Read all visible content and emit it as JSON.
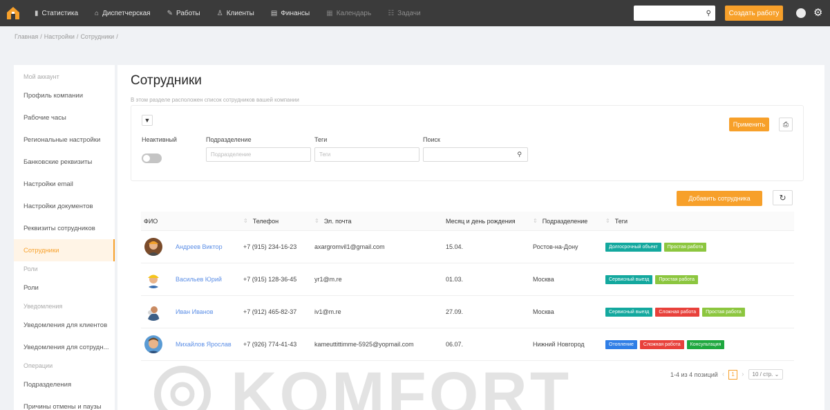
{
  "topnav": {
    "items": [
      {
        "icon": "chart-icon",
        "label": "Статистика"
      },
      {
        "icon": "dispatch-icon",
        "label": "Диспетчерская"
      },
      {
        "icon": "wrench-icon",
        "label": "Работы"
      },
      {
        "icon": "user-icon",
        "label": "Клиенты"
      },
      {
        "icon": "wallet-icon",
        "label": "Финансы"
      },
      {
        "icon": "calendar-icon",
        "label": "Календарь"
      },
      {
        "icon": "tasks-icon",
        "label": "Задачи"
      }
    ],
    "search_placeholder": "",
    "create_button": "Создать работу"
  },
  "breadcrumb": [
    "Главная",
    "Настройки",
    "Сотрудники"
  ],
  "sidebar": {
    "groups": [
      {
        "title": "Мой аккаунт",
        "items": [
          "Профиль компании",
          "Рабочие часы",
          "Региональные настройки",
          "Банковские реквизиты",
          "Настройки email",
          "Настройки документов",
          "Реквизиты сотрудников",
          "Сотрудники"
        ]
      },
      {
        "title": "Роли",
        "items": [
          "Роли"
        ]
      },
      {
        "title": "Уведомления",
        "items": [
          "Уведомления для клиентов",
          "Уведомления для сотрудн..."
        ]
      },
      {
        "title": "Операции",
        "items": [
          "Подразделения",
          "Причины отмены и паузы"
        ]
      }
    ],
    "active_item": "Сотрудники"
  },
  "main": {
    "title": "Сотрудники",
    "description": "В этом разделе расположен список сотрудников вашей компании",
    "apply_button": "Применить",
    "filters": {
      "inactive_label": "Неактивный",
      "division_label": "Подразделение",
      "division_placeholder": "Подразделение",
      "tags_label": "Теги",
      "tags_placeholder": "Теги",
      "search_label": "Поиск",
      "search_placeholder": ""
    },
    "add_button": "Добавить сотрудника"
  },
  "table": {
    "columns": [
      "ФИО",
      "Телефон",
      "Эл. почта",
      "Месяц и день рождения",
      "Подразделение",
      "Теги"
    ],
    "rows": [
      {
        "name": "Андреев Виктор",
        "phone": "+7 (915) 234-16-23",
        "email": "axargromvil1@gmail.com",
        "birthday": "15.04.",
        "division": "Ростов-на-Дону",
        "tags": [
          {
            "label": "Долгосрочный объект",
            "color": "#13a89e"
          },
          {
            "label": "Простая работа",
            "color": "#8cc63f"
          }
        ]
      },
      {
        "name": "Васильев Юрий",
        "phone": "+7 (915) 128-36-45",
        "email": "yr1@m.re",
        "birthday": "01.03.",
        "division": "Москва",
        "tags": [
          {
            "label": "Сервисный выезд",
            "color": "#13a89e"
          },
          {
            "label": "Простая работа",
            "color": "#8cc63f"
          }
        ]
      },
      {
        "name": "Иван Иванов",
        "phone": "+7 (912) 465-82-37",
        "email": "iv1@m.re",
        "birthday": "27.09.",
        "division": "Москва",
        "tags": [
          {
            "label": "Сервисный выезд",
            "color": "#13a89e"
          },
          {
            "label": "Сложная работа",
            "color": "#e8413b"
          },
          {
            "label": "Простая работа",
            "color": "#8cc63f"
          }
        ]
      },
      {
        "name": "Михайлов Ярослав",
        "phone": "+7 (926) 774-41-43",
        "email": "kameuttittimme-5925@yopmail.com",
        "birthday": "06.07.",
        "division": "Нижний Новгород",
        "tags": [
          {
            "label": "Отопление",
            "color": "#2f7ee6"
          },
          {
            "label": "Сложная работа",
            "color": "#e8413b"
          },
          {
            "label": "Консультация",
            "color": "#1fa83f"
          }
        ]
      }
    ]
  },
  "pagination": {
    "summary": "1-4 из 4 позиций",
    "current_page": "1",
    "page_size": "10 / стр."
  },
  "watermark": "KOMFORT",
  "colors": {
    "accent": "#f7a02a",
    "topbar": "#3b3b3b",
    "link": "#5b8ee6"
  }
}
